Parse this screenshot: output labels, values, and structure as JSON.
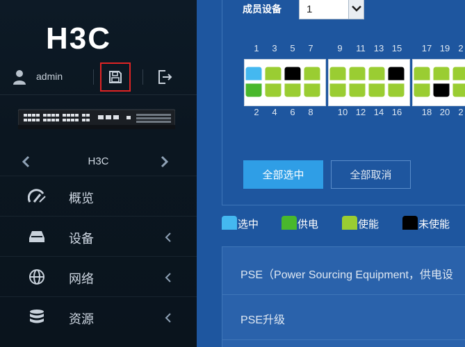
{
  "sidebar": {
    "logo_text": "H3C",
    "user": {
      "name": "admin"
    },
    "device_selector": {
      "name": "H3C"
    },
    "menu": [
      {
        "label": "概览",
        "icon": "gauge-icon",
        "has_chevron": false
      },
      {
        "label": "设备",
        "icon": "hard-drive-icon",
        "has_chevron": true
      },
      {
        "label": "网络",
        "icon": "globe-icon",
        "has_chevron": true
      },
      {
        "label": "资源",
        "icon": "database-icon",
        "has_chevron": true
      }
    ]
  },
  "main": {
    "member_device_label": "成员设备",
    "member_device_value": "1",
    "port_numbers_top": [
      "1",
      "3",
      "5",
      "7",
      "9",
      "11",
      "13",
      "15",
      "17",
      "19",
      "2"
    ],
    "port_numbers_bottom": [
      "2",
      "4",
      "6",
      "8",
      "10",
      "12",
      "14",
      "16",
      "18",
      "20",
      "2"
    ],
    "buttons": {
      "select_all": "全部选中",
      "deselect_all": "全部取消"
    },
    "legend": [
      {
        "label": "选中",
        "color": "#44b8f0"
      },
      {
        "label": "供电",
        "color": "#49b82c"
      },
      {
        "label": "使能",
        "color": "#9acd32"
      },
      {
        "label": "未使能",
        "color": "#000000"
      }
    ],
    "info": {
      "row1": "PSE（Power Sourcing Equipment，供电设",
      "row2": "PSE升级"
    }
  },
  "colors": {
    "sidebar_bg": "#0b1620",
    "main_bg": "#1e569f",
    "accent_blue": "#2f9ee6",
    "highlight_red": "#e02424"
  }
}
